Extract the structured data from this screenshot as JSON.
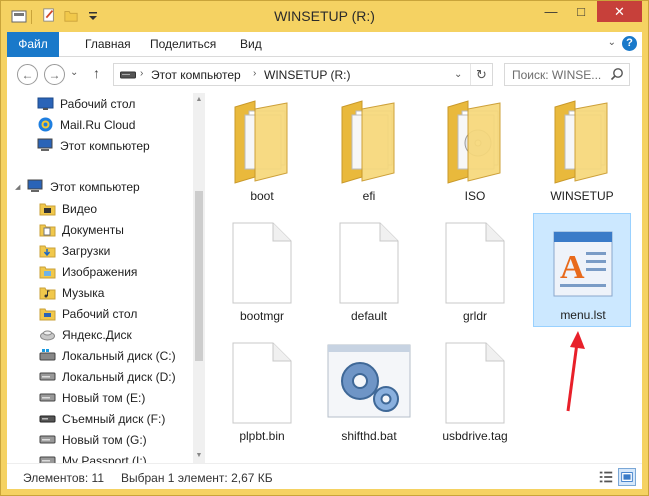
{
  "window": {
    "title": "WINSETUP (R:)",
    "close_label": "✕",
    "minimize_label": "—",
    "maximize_label": "□"
  },
  "ribbon": {
    "tabs": [
      "Файл",
      "Главная",
      "Поделиться",
      "Вид"
    ],
    "expand_glyph": "⌄",
    "help_glyph": "?"
  },
  "nav": {
    "back_glyph": "←",
    "forward_glyph": "→",
    "recent_glyph": "⌄",
    "up_glyph": "↑",
    "breadcrumb": [
      "Этот компьютер",
      "WINSETUP (R:)"
    ],
    "crumb_sep": "›",
    "address_dropdown": "⌄",
    "refresh_glyph": "↻",
    "search_placeholder": "Поиск: WINSE..."
  },
  "sidebar": {
    "items": [
      {
        "label": "Рабочий стол",
        "icon": "desktop-icon"
      },
      {
        "label": "Mail.Ru Cloud",
        "icon": "cloud-icon"
      },
      {
        "label": "Этот компьютер",
        "icon": "computer-icon"
      },
      {
        "label": "Этот компьютер",
        "icon": "computer-icon",
        "expanded": true
      },
      {
        "label": "Видео",
        "icon": "video-folder-icon"
      },
      {
        "label": "Документы",
        "icon": "documents-folder-icon"
      },
      {
        "label": "Загрузки",
        "icon": "downloads-folder-icon"
      },
      {
        "label": "Изображения",
        "icon": "pictures-folder-icon"
      },
      {
        "label": "Музыка",
        "icon": "music-folder-icon"
      },
      {
        "label": "Рабочий стол",
        "icon": "desktop-folder-icon"
      },
      {
        "label": "Яндекс.Диск",
        "icon": "yandex-disk-icon"
      },
      {
        "label": "Локальный диск (C:)",
        "icon": "windows-drive-icon"
      },
      {
        "label": "Локальный диск (D:)",
        "icon": "drive-icon"
      },
      {
        "label": "Новый том (E:)",
        "icon": "drive-icon"
      },
      {
        "label": "Съемный диск (F:)",
        "icon": "removable-drive-icon"
      },
      {
        "label": "Новый том (G:)",
        "icon": "drive-icon"
      },
      {
        "label": "My Passport (I:)",
        "icon": "drive-icon"
      }
    ]
  },
  "files": [
    {
      "name": "boot",
      "type": "folder"
    },
    {
      "name": "efi",
      "type": "folder"
    },
    {
      "name": "ISO",
      "type": "folder-disc"
    },
    {
      "name": "WINSETUP",
      "type": "folder"
    },
    {
      "name": "bootmgr",
      "type": "blank-file"
    },
    {
      "name": "default",
      "type": "blank-file"
    },
    {
      "name": "grldr",
      "type": "blank-file"
    },
    {
      "name": "menu.lst",
      "type": "wordpad-file",
      "selected": true
    },
    {
      "name": "plpbt.bin",
      "type": "blank-file"
    },
    {
      "name": "shifthd.bat",
      "type": "batch-file"
    },
    {
      "name": "usbdrive.tag",
      "type": "blank-file"
    }
  ],
  "status": {
    "items_count": "Элементов: 11",
    "selection": "Выбран 1 элемент: 2,67 КБ"
  },
  "colors": {
    "frame": "#f5d262",
    "file_tab": "#1979ca",
    "selection_bg": "#cce8ff",
    "selection_border": "#99d1ff",
    "annotation_arrow": "#e8202a"
  }
}
